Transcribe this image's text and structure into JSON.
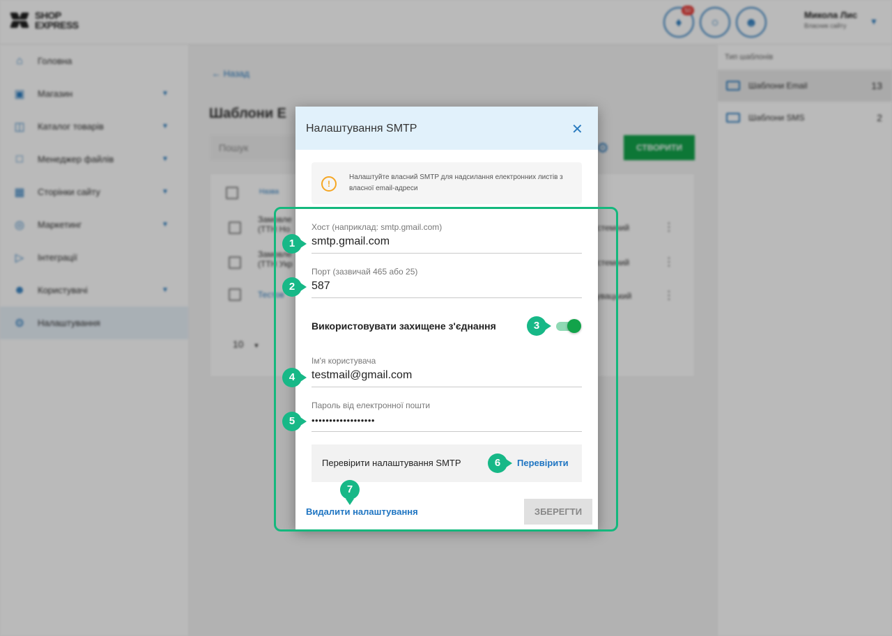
{
  "header": {
    "logo_line1": "SHOP",
    "logo_line2": "EXPRESS",
    "notifications_badge": "50",
    "user_name": "Микола Лис",
    "user_subtitle": "Власник сайту"
  },
  "sidebar": {
    "items": [
      {
        "label": "Головна",
        "icon": "home-icon"
      },
      {
        "label": "Магазин",
        "icon": "cart-icon"
      },
      {
        "label": "Каталог товарів",
        "icon": "book-icon"
      },
      {
        "label": "Менеджер файлів",
        "icon": "folder-icon"
      },
      {
        "label": "Сторінки сайту",
        "icon": "page-icon"
      },
      {
        "label": "Маркетинг",
        "icon": "marketing-icon"
      },
      {
        "label": "Інтеграції",
        "icon": "megaphone-icon"
      },
      {
        "label": "Користувачі",
        "icon": "user-icon"
      },
      {
        "label": "Налаштування",
        "icon": "gear-icon"
      }
    ]
  },
  "main": {
    "back_label": "Назад",
    "title": "Шаблони E",
    "search_placeholder": "Пошук",
    "create_label": "СТВОРИТИ",
    "column_name": "Назва",
    "rows": [
      {
        "name_line1": "Замовле",
        "name_line2": "(ТТН Но",
        "type": "истемний"
      },
      {
        "name_line1": "Замовле",
        "name_line2": "(ТТН Укр",
        "type": "истемний"
      },
      {
        "name_line1": "Тестов",
        "name_line2": "",
        "type": "тувацький"
      }
    ],
    "per_page": "10"
  },
  "right_panel": {
    "header": "Тип шаблонів",
    "items": [
      {
        "label": "Шаблони Email",
        "count": "13"
      },
      {
        "label": "Шаблони SMS",
        "count": "2"
      }
    ]
  },
  "modal": {
    "title": "Налаштування SMTP",
    "info_text": "Налаштуйте власний SMTP для надсилання електронних листів з власної email-адреси",
    "host_label": "Хост (наприклад: smtp.gmail.com)",
    "host_value": "smtp.gmail.com",
    "port_label": "Порт (зазвичай 465 або 25)",
    "port_value": "587",
    "secure_label": "Використовувати захищене з'єднання",
    "secure_enabled": true,
    "username_label": "Ім'я користувача",
    "username_value": "testmail@gmail.com",
    "password_label": "Пароль від електронної пошти",
    "password_value": "••••••••••••••••••",
    "check_label": "Перевірити налаштування SMTP",
    "check_link": "Перевірити",
    "delete_label": "Видалити налаштування",
    "save_label": "ЗБЕРЕГТИ"
  },
  "markers": [
    "1",
    "2",
    "3",
    "4",
    "5",
    "6",
    "7"
  ],
  "colors": {
    "accent": "#2a7bbf",
    "highlight": "#14b87d",
    "create_button": "#12a34a",
    "modal_header": "#e1f1fb"
  }
}
